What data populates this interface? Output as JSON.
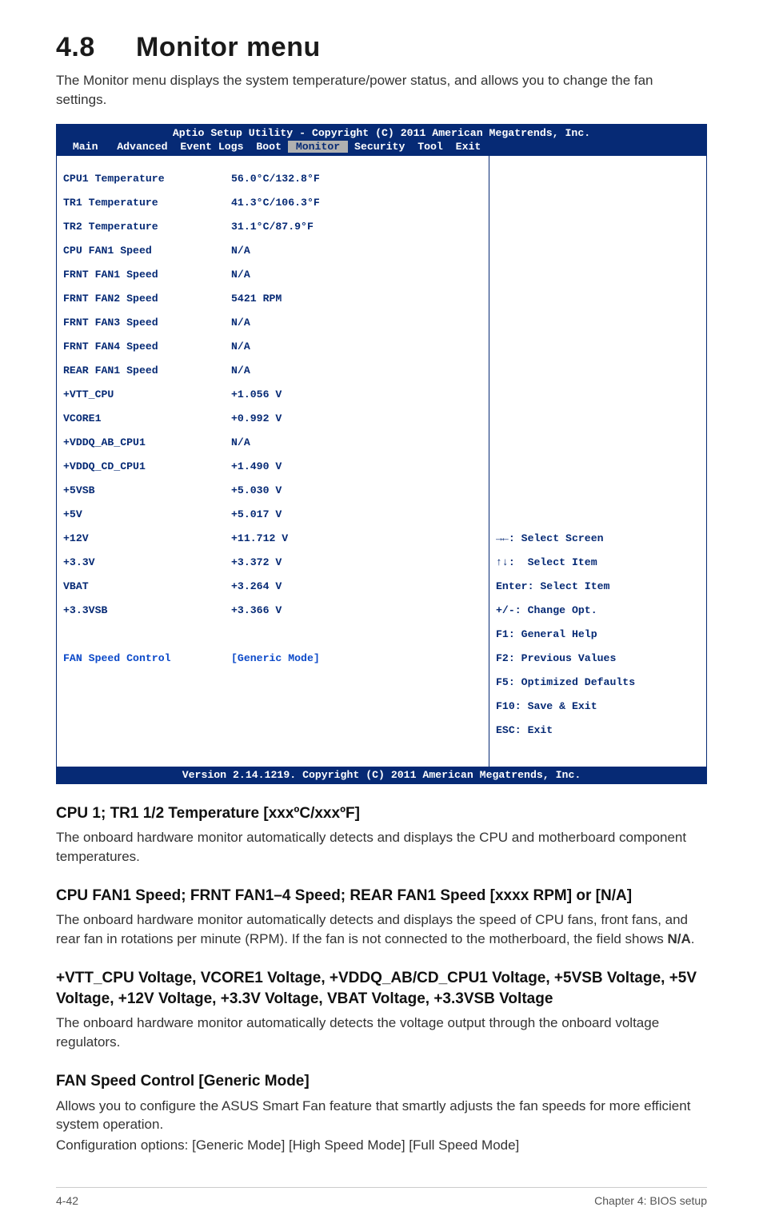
{
  "section": {
    "number": "4.8",
    "title": "Monitor menu",
    "intro": "The Monitor menu displays the system temperature/power status, and allows you to change the fan settings."
  },
  "bios": {
    "header_line": "Aptio Setup Utility - Copyright (C) 2011 American Megatrends, Inc.",
    "tabs": {
      "prefix": "  Main   Advanced  Event Logs  Boot ",
      "active": " Monitor ",
      "suffix": " Security  Tool  Exit"
    },
    "rows": [
      {
        "label": "CPU1 Temperature",
        "value": "56.0°C/132.8°F"
      },
      {
        "label": "TR1 Temperature",
        "value": "41.3°C/106.3°F"
      },
      {
        "label": "TR2 Temperature",
        "value": "31.1°C/87.9°F"
      },
      {
        "label": "CPU FAN1 Speed",
        "value": "N/A"
      },
      {
        "label": "FRNT FAN1 Speed",
        "value": "N/A"
      },
      {
        "label": "FRNT FAN2 Speed",
        "value": "5421 RPM"
      },
      {
        "label": "FRNT FAN3 Speed",
        "value": "N/A"
      },
      {
        "label": "FRNT FAN4 Speed",
        "value": "N/A"
      },
      {
        "label": "REAR FAN1 Speed",
        "value": "N/A"
      },
      {
        "label": "+VTT_CPU",
        "value": "+1.056 V"
      },
      {
        "label": "VCORE1",
        "value": "+0.992 V"
      },
      {
        "label": "+VDDQ_AB_CPU1",
        "value": "N/A"
      },
      {
        "label": "+VDDQ_CD_CPU1",
        "value": "+1.490 V"
      },
      {
        "label": "+5VSB",
        "value": "+5.030 V"
      },
      {
        "label": "+5V",
        "value": "+5.017 V"
      },
      {
        "label": "+12V",
        "value": "+11.712 V"
      },
      {
        "label": "+3.3V",
        "value": "+3.372 V"
      },
      {
        "label": "VBAT",
        "value": "+3.264 V"
      },
      {
        "label": "+3.3VSB",
        "value": "+3.366 V"
      }
    ],
    "fan_control_label": "FAN Speed Control",
    "fan_control_value": "[Generic Mode]",
    "help": [
      "→←: Select Screen",
      "↑↓:  Select Item",
      "Enter: Select Item",
      "+/-: Change Opt.",
      "F1: General Help",
      "F2: Previous Values",
      "F5: Optimized Defaults",
      "F10: Save & Exit",
      "ESC: Exit"
    ],
    "footer": "Version 2.14.1219. Copyright (C) 2011 American Megatrends, Inc."
  },
  "subsections": {
    "s1": {
      "title": "CPU 1; TR1 1/2 Temperature [xxxºC/xxxºF]",
      "body": "The onboard hardware monitor automatically detects and displays the CPU and motherboard component temperatures."
    },
    "s2": {
      "title": "CPU FAN1 Speed; FRNT FAN1–4 Speed; REAR FAN1 Speed [xxxx RPM] or [N/A]",
      "body_a": "The onboard hardware monitor automatically detects and displays the speed of CPU fans, front fans, and rear fan in rotations per minute (RPM). If the fan is not connected to the motherboard, the field shows ",
      "body_b": "N/A",
      "body_c": "."
    },
    "s3": {
      "title": "+VTT_CPU Voltage, VCORE1 Voltage, +VDDQ_AB/CD_CPU1 Voltage, +5VSB Voltage, +5V Voltage, +12V Voltage, +3.3V Voltage, VBAT Voltage, +3.3VSB Voltage",
      "body": "The onboard hardware monitor automatically detects the voltage output through the onboard voltage regulators."
    },
    "s4": {
      "title": "FAN Speed Control [Generic Mode]",
      "body1": "Allows you to configure the ASUS Smart Fan feature that smartly adjusts the fan speeds for more efficient system operation.",
      "body2": "Configuration options: [Generic Mode] [High Speed Mode] [Full Speed Mode]"
    }
  },
  "footer": {
    "left": "4-42",
    "right": "Chapter 4: BIOS setup"
  }
}
